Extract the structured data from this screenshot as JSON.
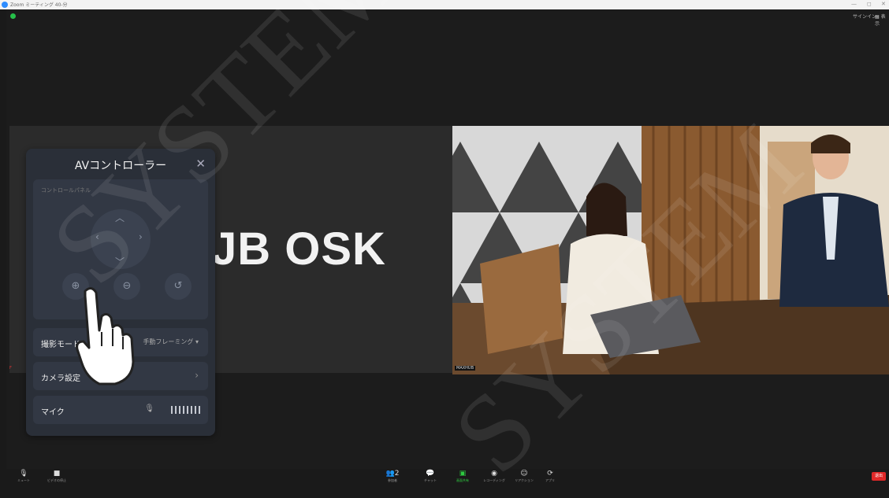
{
  "window": {
    "title": "Zoom ミーティング 40-分",
    "controls": [
      "—",
      "◻",
      "✕"
    ]
  },
  "top_right": {
    "sign_in": "サインイン",
    "view": "表示"
  },
  "shared_screen": {
    "text": "JB OSK"
  },
  "video": {
    "name_tag": "MAXHUB",
    "left_tag": "F"
  },
  "av_panel": {
    "title": "AVコントローラー",
    "close": "✕",
    "control_panel_label": "コントロールパネル",
    "zoom_in_icon": "⊕",
    "zoom_out_icon": "⊖",
    "reset_icon": "↺",
    "shooting_mode": {
      "label": "撮影モード",
      "value": "手動フレーミング ▾"
    },
    "camera_settings": {
      "label": "カメラ設定",
      "chevron": "›"
    },
    "mic": {
      "label": "マイク",
      "level_bars": 8
    }
  },
  "toolbar": {
    "mute": "ミュート",
    "video": "ビデオの停止",
    "participants": "参加者",
    "participants_count": "2",
    "chat": "チャット",
    "share": "画面共有",
    "record": "レコーディング",
    "reactions": "リアクション",
    "apps": "アプリ",
    "leave": "退出"
  },
  "watermark": "SYSTEM"
}
